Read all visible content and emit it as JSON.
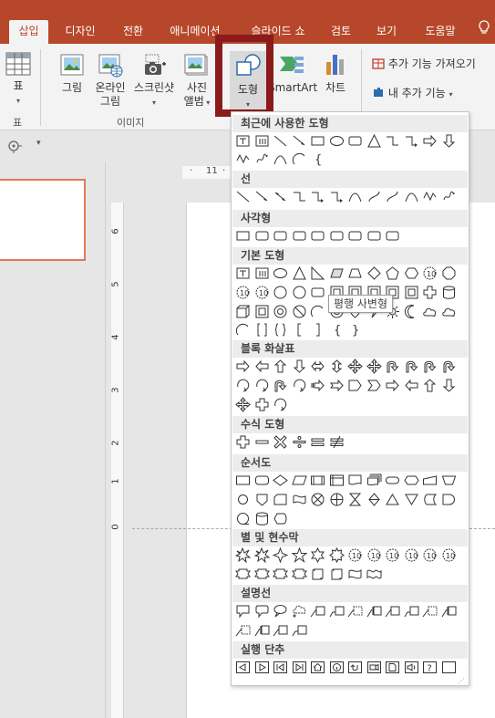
{
  "tabs": [
    {
      "label": "삽입",
      "active": true
    },
    {
      "label": "디자인",
      "active": false
    },
    {
      "label": "전환",
      "active": false
    },
    {
      "label": "애니메이션",
      "active": false
    },
    {
      "label": "슬라이드 쇼",
      "active": false
    },
    {
      "label": "검토",
      "active": false
    },
    {
      "label": "보기",
      "active": false
    },
    {
      "label": "도움말",
      "active": false
    }
  ],
  "ribbon": {
    "table_btn": "표",
    "table_group": "표",
    "picture_btn": "그림",
    "online_picture_line1": "온라인",
    "online_picture_line2": "그림",
    "screenshot_btn": "스크린샷",
    "photo_album_line1": "사진",
    "photo_album_line2": "앨범",
    "images_group": "이미지",
    "shapes_btn": "도형",
    "smartart_btn": "SmartArt",
    "chart_btn": "차트",
    "get_addins": "추가 기능 가져오기",
    "my_addins": "내 추가 기능"
  },
  "ruler": {
    "h_label": "11"
  },
  "vruler_labels": [
    "6",
    "5",
    "4",
    "3",
    "2",
    "1",
    "0"
  ],
  "gallery": {
    "sections": [
      "최근에 사용한 도형",
      "선",
      "사각형",
      "기본 도형",
      "블록 화살표",
      "수식 도형",
      "순서도",
      "별 및 현수막",
      "설명선",
      "실행 단추"
    ],
    "tooltip": "평행 사변형",
    "recent_extra": "{"
  },
  "colors": {
    "accent": "#b7472a",
    "highlight": "#8b1a1a"
  }
}
